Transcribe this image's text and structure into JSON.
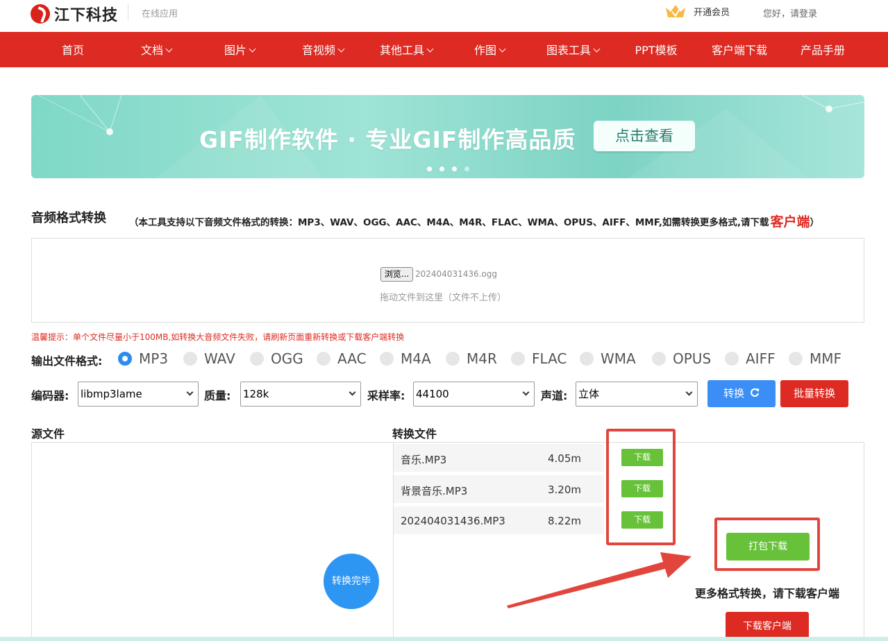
{
  "header": {
    "brand": "江下科技",
    "subtitle": "在线应用",
    "vip_label": "开通会员",
    "login_label": "您好，请登录"
  },
  "nav": {
    "items": [
      {
        "label": "首页",
        "dropdown": false
      },
      {
        "label": "文档",
        "dropdown": true
      },
      {
        "label": "图片",
        "dropdown": true
      },
      {
        "label": "音视频",
        "dropdown": true
      },
      {
        "label": "其他工具",
        "dropdown": true
      },
      {
        "label": "作图",
        "dropdown": true
      },
      {
        "label": "图表工具",
        "dropdown": true
      },
      {
        "label": "PPT模板",
        "dropdown": false
      },
      {
        "label": "客户端下载",
        "dropdown": false
      },
      {
        "label": "产品手册",
        "dropdown": false
      }
    ]
  },
  "banner": {
    "title": "GIF制作软件 · 专业GIF制作高品质",
    "button": "点击查看",
    "slide_count": 4,
    "active_slide": 4
  },
  "tool": {
    "title": "音频格式转换",
    "note_prefix": "（本工具支持以下音频文件格式的转换：MP3、WAV、OGG、AAC、M4A、M4R、FLAC、WMA、OPUS、AIFF、MMF,如需转换更多格式,请下载",
    "note_link": "客户端",
    "note_suffix": "）"
  },
  "upload": {
    "browse_label": "浏览...",
    "file_name": "202404031436.ogg",
    "drop_hint": "拖动文件到这里（文件不上传）"
  },
  "tip": "温馨提示：单个文件尽量小于100MB,如转换大音频文件失败，请刷新页面重新转换或下载客户端转换",
  "formats": {
    "label": "输出文件格式:",
    "options": [
      "MP3",
      "WAV",
      "OGG",
      "AAC",
      "M4A",
      "M4R",
      "FLAC",
      "WMA",
      "OPUS",
      "AIFF",
      "MMF"
    ],
    "selected": "MP3"
  },
  "settings": {
    "encoder_label": "编码器:",
    "encoder_value": "libmp3lame",
    "quality_label": "质量:",
    "quality_value": "128k",
    "samplerate_label": "采样率:",
    "samplerate_value": "44100",
    "channel_label": "声道:",
    "channel_value": "立体",
    "convert_button": "转换",
    "batch_button": "批量转换"
  },
  "source": {
    "title": "源文件"
  },
  "status": {
    "done_label": "转换完毕"
  },
  "output": {
    "title": "转换文件",
    "files": [
      {
        "name": "音乐.MP3",
        "size": "4.05m",
        "download": "下载"
      },
      {
        "name": "背景音乐.MP3",
        "size": "3.20m",
        "download": "下载"
      },
      {
        "name": "202404031436.MP3",
        "size": "8.22m",
        "download": "下载"
      }
    ],
    "pack_button": "打包下载",
    "more_text": "更多格式转换，请下载客户端",
    "client_button": "下载客户端"
  },
  "colors": {
    "brand_red": "#dd2a22",
    "primary_blue": "#3a8ef6",
    "success_green": "#67c23a",
    "annotation_red": "#e2453c"
  }
}
